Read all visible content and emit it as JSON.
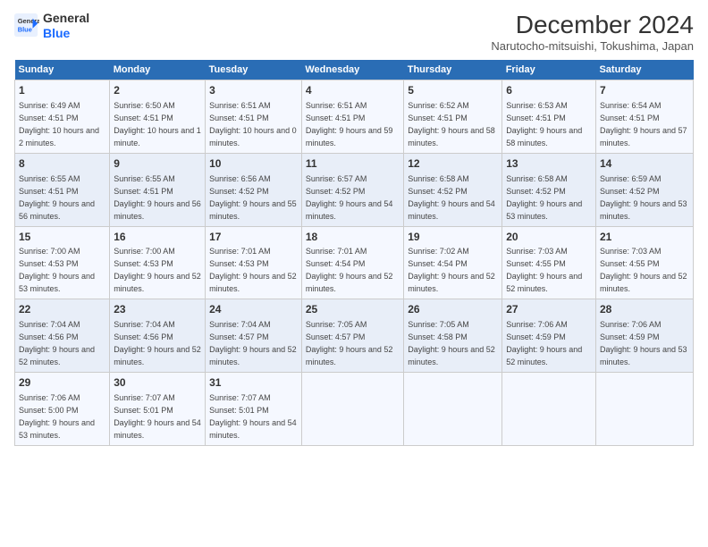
{
  "header": {
    "logo_line1": "General",
    "logo_line2": "Blue",
    "title": "December 2024",
    "subtitle": "Narutocho-mitsuishi, Tokushima, Japan"
  },
  "weekdays": [
    "Sunday",
    "Monday",
    "Tuesday",
    "Wednesday",
    "Thursday",
    "Friday",
    "Saturday"
  ],
  "weeks": [
    [
      {
        "day": "1",
        "sunrise": "6:49 AM",
        "sunset": "4:51 PM",
        "daylight": "10 hours and 2 minutes."
      },
      {
        "day": "2",
        "sunrise": "6:50 AM",
        "sunset": "4:51 PM",
        "daylight": "10 hours and 1 minute."
      },
      {
        "day": "3",
        "sunrise": "6:51 AM",
        "sunset": "4:51 PM",
        "daylight": "10 hours and 0 minutes."
      },
      {
        "day": "4",
        "sunrise": "6:51 AM",
        "sunset": "4:51 PM",
        "daylight": "9 hours and 59 minutes."
      },
      {
        "day": "5",
        "sunrise": "6:52 AM",
        "sunset": "4:51 PM",
        "daylight": "9 hours and 58 minutes."
      },
      {
        "day": "6",
        "sunrise": "6:53 AM",
        "sunset": "4:51 PM",
        "daylight": "9 hours and 58 minutes."
      },
      {
        "day": "7",
        "sunrise": "6:54 AM",
        "sunset": "4:51 PM",
        "daylight": "9 hours and 57 minutes."
      }
    ],
    [
      {
        "day": "8",
        "sunrise": "6:55 AM",
        "sunset": "4:51 PM",
        "daylight": "9 hours and 56 minutes."
      },
      {
        "day": "9",
        "sunrise": "6:55 AM",
        "sunset": "4:51 PM",
        "daylight": "9 hours and 56 minutes."
      },
      {
        "day": "10",
        "sunrise": "6:56 AM",
        "sunset": "4:52 PM",
        "daylight": "9 hours and 55 minutes."
      },
      {
        "day": "11",
        "sunrise": "6:57 AM",
        "sunset": "4:52 PM",
        "daylight": "9 hours and 54 minutes."
      },
      {
        "day": "12",
        "sunrise": "6:58 AM",
        "sunset": "4:52 PM",
        "daylight": "9 hours and 54 minutes."
      },
      {
        "day": "13",
        "sunrise": "6:58 AM",
        "sunset": "4:52 PM",
        "daylight": "9 hours and 53 minutes."
      },
      {
        "day": "14",
        "sunrise": "6:59 AM",
        "sunset": "4:52 PM",
        "daylight": "9 hours and 53 minutes."
      }
    ],
    [
      {
        "day": "15",
        "sunrise": "7:00 AM",
        "sunset": "4:53 PM",
        "daylight": "9 hours and 53 minutes."
      },
      {
        "day": "16",
        "sunrise": "7:00 AM",
        "sunset": "4:53 PM",
        "daylight": "9 hours and 52 minutes."
      },
      {
        "day": "17",
        "sunrise": "7:01 AM",
        "sunset": "4:53 PM",
        "daylight": "9 hours and 52 minutes."
      },
      {
        "day": "18",
        "sunrise": "7:01 AM",
        "sunset": "4:54 PM",
        "daylight": "9 hours and 52 minutes."
      },
      {
        "day": "19",
        "sunrise": "7:02 AM",
        "sunset": "4:54 PM",
        "daylight": "9 hours and 52 minutes."
      },
      {
        "day": "20",
        "sunrise": "7:03 AM",
        "sunset": "4:55 PM",
        "daylight": "9 hours and 52 minutes."
      },
      {
        "day": "21",
        "sunrise": "7:03 AM",
        "sunset": "4:55 PM",
        "daylight": "9 hours and 52 minutes."
      }
    ],
    [
      {
        "day": "22",
        "sunrise": "7:04 AM",
        "sunset": "4:56 PM",
        "daylight": "9 hours and 52 minutes."
      },
      {
        "day": "23",
        "sunrise": "7:04 AM",
        "sunset": "4:56 PM",
        "daylight": "9 hours and 52 minutes."
      },
      {
        "day": "24",
        "sunrise": "7:04 AM",
        "sunset": "4:57 PM",
        "daylight": "9 hours and 52 minutes."
      },
      {
        "day": "25",
        "sunrise": "7:05 AM",
        "sunset": "4:57 PM",
        "daylight": "9 hours and 52 minutes."
      },
      {
        "day": "26",
        "sunrise": "7:05 AM",
        "sunset": "4:58 PM",
        "daylight": "9 hours and 52 minutes."
      },
      {
        "day": "27",
        "sunrise": "7:06 AM",
        "sunset": "4:59 PM",
        "daylight": "9 hours and 52 minutes."
      },
      {
        "day": "28",
        "sunrise": "7:06 AM",
        "sunset": "4:59 PM",
        "daylight": "9 hours and 53 minutes."
      }
    ],
    [
      {
        "day": "29",
        "sunrise": "7:06 AM",
        "sunset": "5:00 PM",
        "daylight": "9 hours and 53 minutes."
      },
      {
        "day": "30",
        "sunrise": "7:07 AM",
        "sunset": "5:01 PM",
        "daylight": "9 hours and 54 minutes."
      },
      {
        "day": "31",
        "sunrise": "7:07 AM",
        "sunset": "5:01 PM",
        "daylight": "9 hours and 54 minutes."
      },
      null,
      null,
      null,
      null
    ]
  ]
}
